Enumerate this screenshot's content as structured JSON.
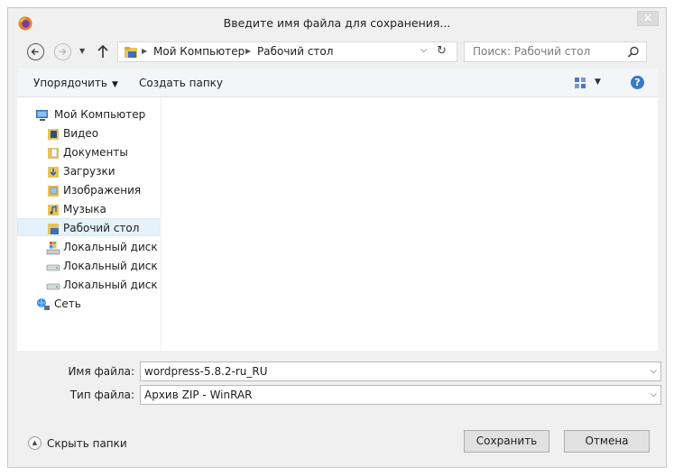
{
  "window": {
    "title": "Введите имя файла для сохранения...",
    "close_glyph": "✕"
  },
  "nav": {
    "address_crumbs": [
      "Мой Компьютер",
      "Рабочий стол"
    ],
    "search_placeholder": "Поиск: Рабочий стол"
  },
  "toolbar": {
    "organize_label": "Упорядочить",
    "new_folder_label": "Создать папку",
    "help_glyph": "?"
  },
  "tree": {
    "items": [
      {
        "label": "Мой Компьютер",
        "icon": "computer-icon"
      },
      {
        "label": "Видео",
        "icon": "video-folder-icon"
      },
      {
        "label": "Документы",
        "icon": "documents-folder-icon"
      },
      {
        "label": "Загрузки",
        "icon": "downloads-folder-icon"
      },
      {
        "label": "Изображения",
        "icon": "pictures-folder-icon"
      },
      {
        "label": "Музыка",
        "icon": "music-folder-icon"
      },
      {
        "label": "Рабочий стол",
        "icon": "desktop-folder-icon",
        "selected": true
      },
      {
        "label": "Локальный диск (C",
        "icon": "system-drive-icon"
      },
      {
        "label": "Локальный диск (E:",
        "icon": "drive-icon"
      },
      {
        "label": "Локальный диск (F:",
        "icon": "drive-icon"
      },
      {
        "label": "Сеть",
        "icon": "network-icon"
      }
    ]
  },
  "form": {
    "filename_label": "Имя файла:",
    "filename_value": "wordpress-5.8.2-ru_RU",
    "filetype_label": "Тип файла:",
    "filetype_value": "Архив ZIP - WinRAR"
  },
  "footer": {
    "hide_folders_label": "Скрыть папки",
    "save_label": "Сохранить",
    "cancel_label": "Отмена"
  },
  "colors": {
    "dialog_bg": "#f0f0f0",
    "selection": "#e5f1fb",
    "help_blue": "#3a78c9"
  }
}
